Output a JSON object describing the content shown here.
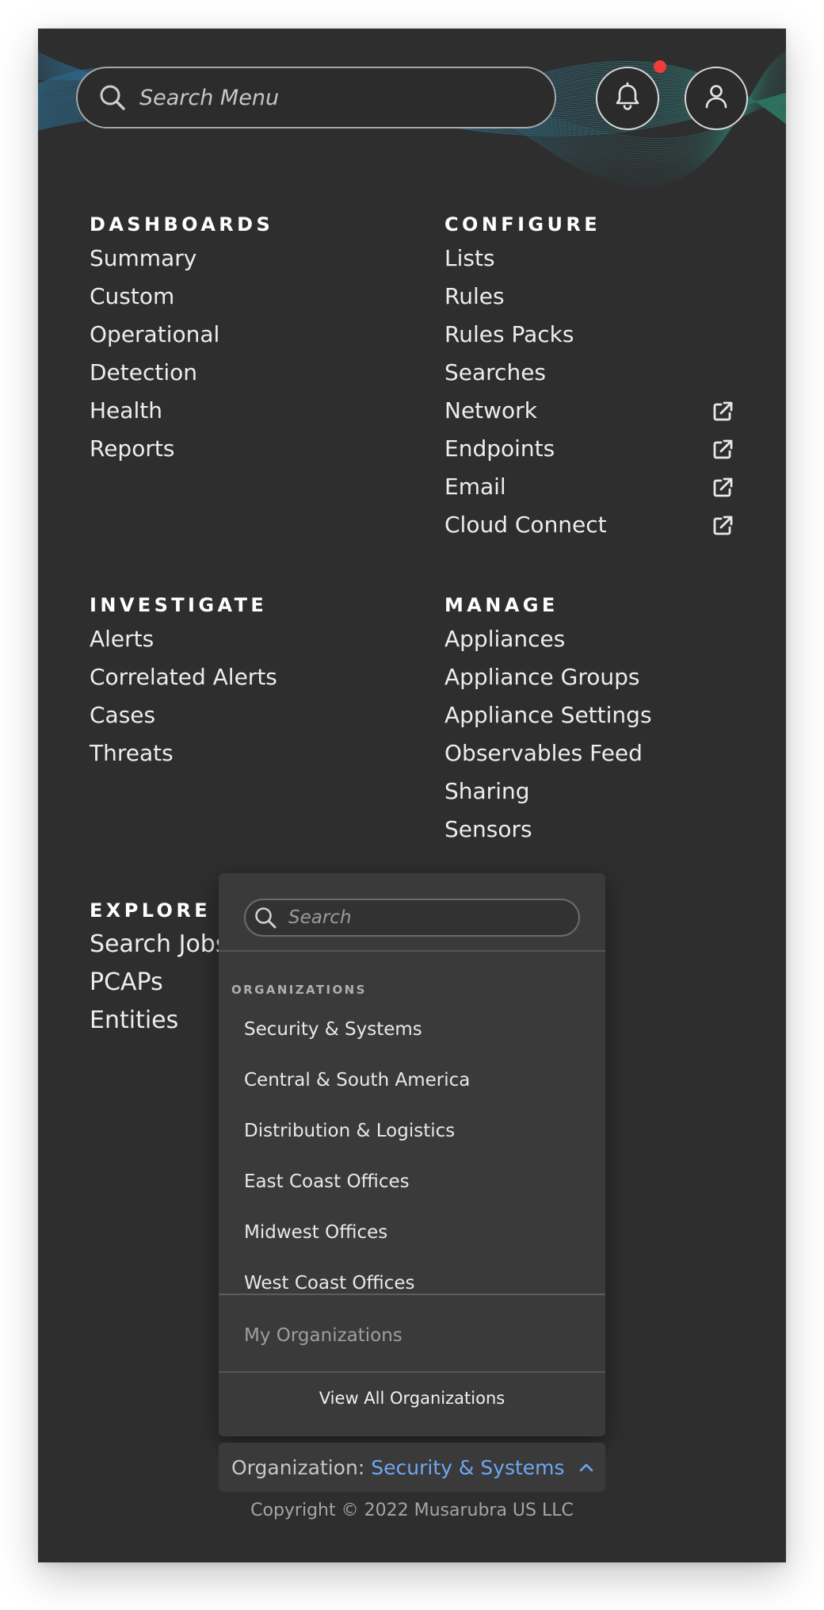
{
  "header": {
    "search_placeholder": "Search Menu",
    "icons": {
      "search": "search-icon",
      "notifications": "bell-icon",
      "account": "user-icon"
    },
    "notification_dot_color": "#f23b3b"
  },
  "sections": {
    "dashboards": {
      "title": "DASHBOARDS",
      "items": [
        "Summary",
        "Custom",
        "Operational",
        "Detection",
        "Health",
        "Reports"
      ]
    },
    "configure": {
      "title": "CONFIGURE",
      "items": [
        "Lists",
        "Rules",
        "Rules Packs",
        "Searches",
        "Network",
        "Endpoints",
        "Email",
        "Cloud Connect"
      ],
      "external_link_items": [
        "Network",
        "Endpoints",
        "Email",
        "Cloud Connect"
      ]
    },
    "investigate": {
      "title": "INVESTIGATE",
      "items": [
        "Alerts",
        "Correlated Alerts",
        "Cases",
        "Threats"
      ]
    },
    "manage": {
      "title": "MANAGE",
      "items": [
        "Appliances",
        "Appliance Groups",
        "Appliance Settings",
        "Observables Feed",
        "Sharing",
        "Sensors"
      ]
    },
    "explore": {
      "title": "EXPLORE",
      "items": [
        "Search Jobs",
        "PCAPs",
        "Entities"
      ]
    }
  },
  "org_popup": {
    "search_placeholder": "Search",
    "heading": "ORGANIZATIONS",
    "organizations": [
      "Security & Systems",
      "Central & South America",
      "Distribution & Logistics",
      "East Coast Offices",
      "Midwest Offices",
      "West Coast Offices"
    ],
    "my_organizations_label": "My Organizations",
    "view_all_label": "View All Organizations"
  },
  "org_selector": {
    "label": "Organization:",
    "value": "Security & Systems",
    "accent_color": "#6fa7f5"
  },
  "footer": {
    "copyright": "Copyright © 2022 Musarubra US LLC"
  }
}
